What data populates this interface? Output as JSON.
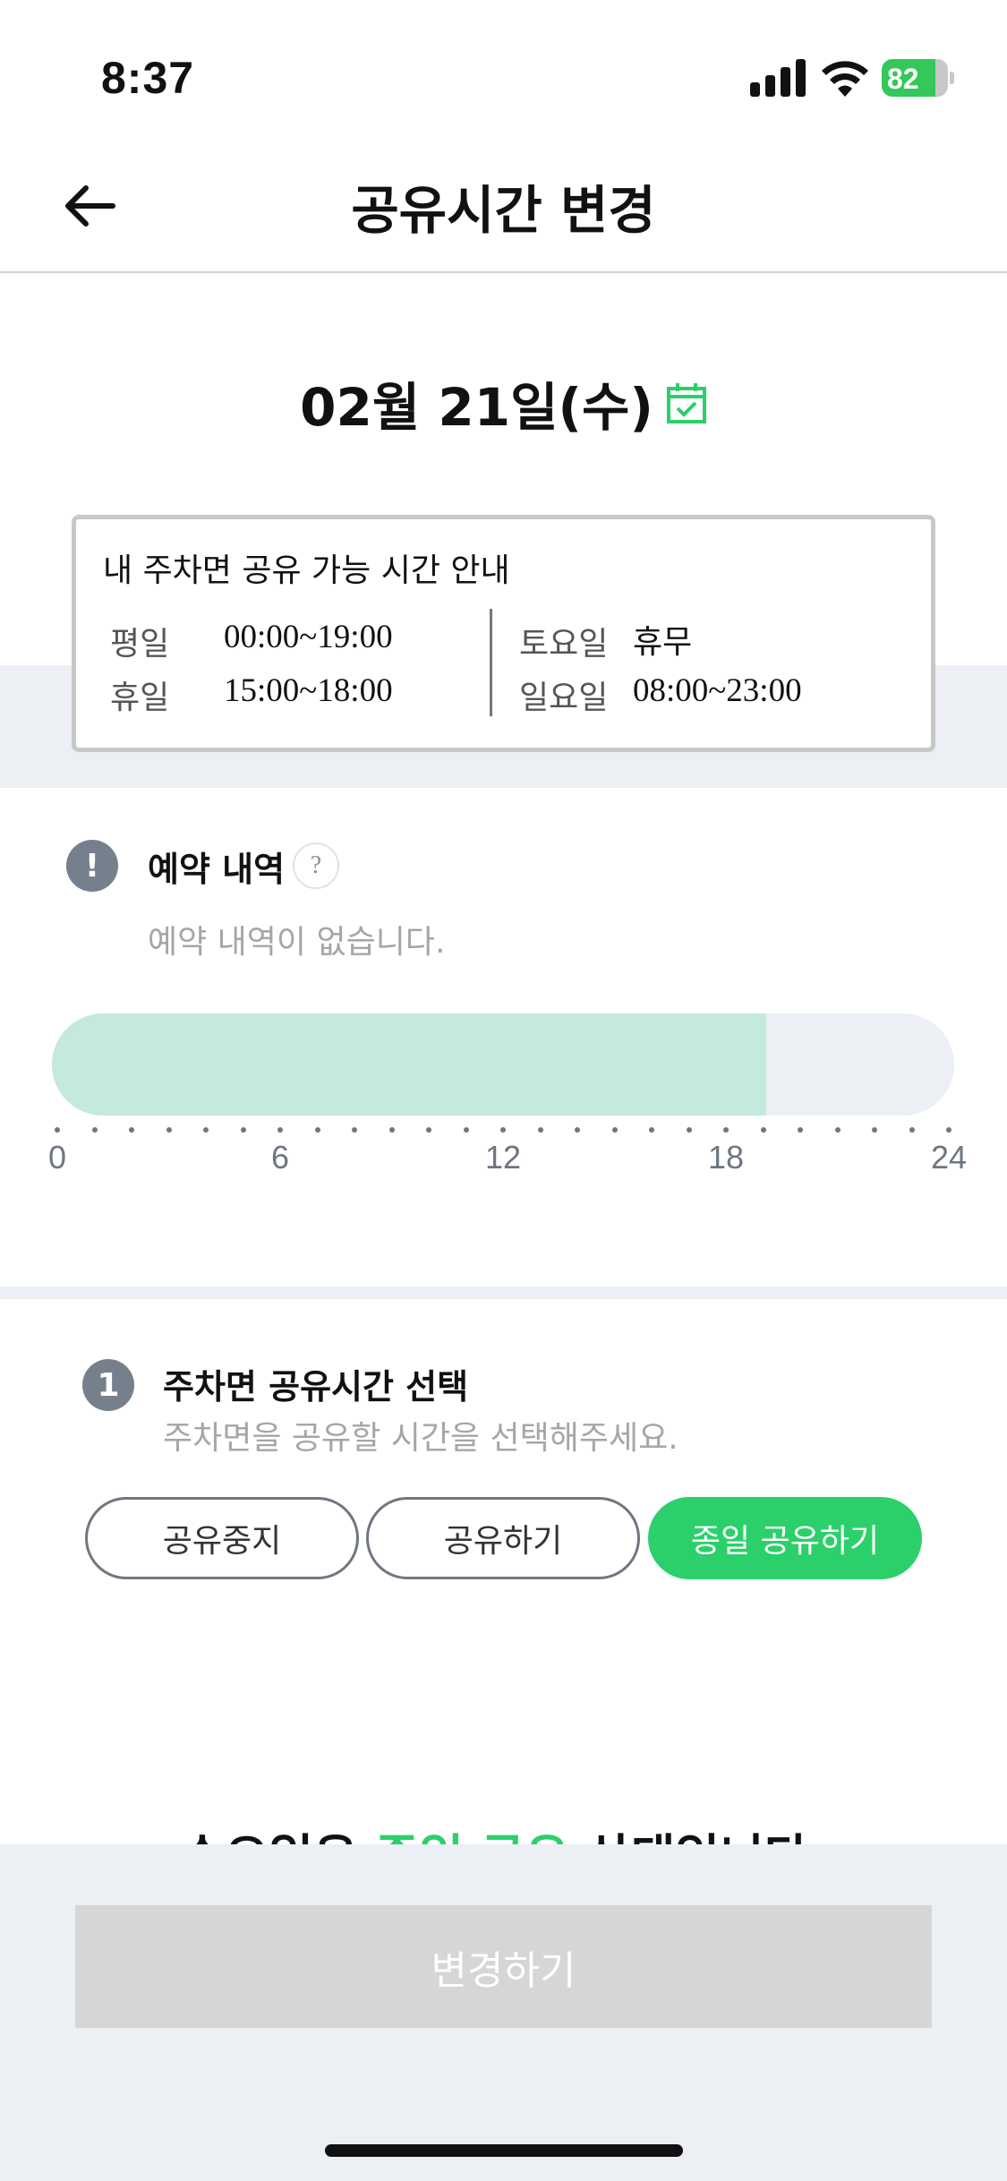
{
  "status_bar": {
    "time": "8:37",
    "battery": "82",
    "icons": [
      "signal-icon",
      "wifi-icon",
      "battery-icon"
    ]
  },
  "header": {
    "title": "공유시간 변경",
    "back_icon": "arrow-left-icon"
  },
  "date": {
    "label": "02월 21일(수)",
    "icon": "calendar-check-icon"
  },
  "share_info": {
    "title": "내 주차면 공유 가능 시간 안내",
    "rows": [
      {
        "label": "평일",
        "value": "00:00~19:00"
      },
      {
        "label": "휴일",
        "value": "15:00~18:00"
      },
      {
        "label": "토요일",
        "value": "휴무"
      },
      {
        "label": "일요일",
        "value": "08:00~23:00"
      }
    ]
  },
  "reservation": {
    "icon_text": "!",
    "title": "예약 내역",
    "help_text": "?",
    "empty_text": "예약 내역이 없습니다."
  },
  "timeline": {
    "shared_start_hour": 0,
    "shared_end_hour": 19,
    "max_hour": 24,
    "tick_labels": [
      "0",
      "6",
      "12",
      "18",
      "24"
    ],
    "colors": {
      "shared": "#c4eadb",
      "track": "#eceff3"
    }
  },
  "selection": {
    "step": "1",
    "title": "주차면 공유시간 선택",
    "subtitle": "주차면을 공유할 시간을 선택해주세요.",
    "options": [
      {
        "label": "공유중지",
        "active": false
      },
      {
        "label": "공유하기",
        "active": false
      },
      {
        "label": "종일 공유하기",
        "active": true
      }
    ],
    "accent": "#2bd06a"
  },
  "status_message": {
    "before": "수요일은 ",
    "highlight": "종일 공유",
    "after": " 상태입니다."
  },
  "footer": {
    "button_label": "변경하기"
  }
}
